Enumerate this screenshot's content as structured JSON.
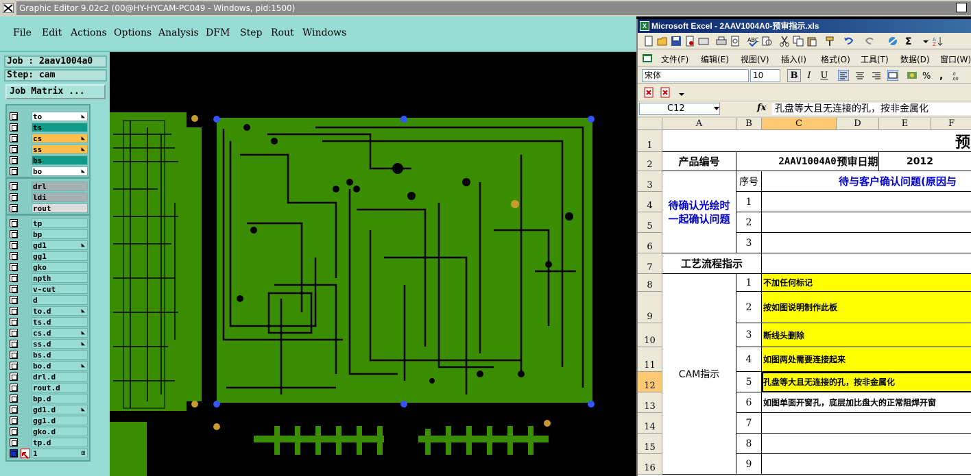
{
  "graphic_editor": {
    "title": "Graphic Editor 9.02c2 (00@HY-HYCAM-PC049 - Windows, pid:1500)",
    "menu": [
      "File",
      "Edit",
      "Actions",
      "Options",
      "Analysis",
      "DFM",
      "Step",
      "Rout",
      "Windows"
    ],
    "job_label": "Job : 2aav1004a0",
    "step_label": "Step: cam",
    "job_matrix_label": "Job Matrix ...",
    "layers": [
      {
        "name": "to",
        "color": "#ffffff",
        "mark": "◣"
      },
      {
        "name": "ts",
        "color": "#119a86",
        "mark": ""
      },
      {
        "name": "cs",
        "color": "#ffc04d",
        "mark": "◣"
      },
      {
        "name": "ss",
        "color": "#ffc04d",
        "mark": "◣"
      },
      {
        "name": "bs",
        "color": "#119a86",
        "mark": ""
      },
      {
        "name": "bo",
        "color": "#ffffff",
        "mark": "◣"
      },
      {
        "name": "drl",
        "color": "#a7b1b3",
        "mark": ""
      },
      {
        "name": "ldi",
        "color": "#a7b1b3",
        "mark": ""
      },
      {
        "name": "rout",
        "color": "#dcdcdc",
        "mark": ""
      },
      {
        "name": "tp",
        "color": "#99dcd4",
        "mark": ""
      },
      {
        "name": "bp",
        "color": "#99dcd4",
        "mark": ""
      },
      {
        "name": "gd1",
        "color": "#99dcd4",
        "mark": "◣"
      },
      {
        "name": "gg1",
        "color": "#99dcd4",
        "mark": ""
      },
      {
        "name": "gko",
        "color": "#99dcd4",
        "mark": ""
      },
      {
        "name": "npth",
        "color": "#99dcd4",
        "mark": ""
      },
      {
        "name": "v-cut",
        "color": "#99dcd4",
        "mark": ""
      },
      {
        "name": "d",
        "color": "#99dcd4",
        "mark": ""
      },
      {
        "name": "to.d",
        "color": "#99dcd4",
        "mark": "◣"
      },
      {
        "name": "ts.d",
        "color": "#99dcd4",
        "mark": ""
      },
      {
        "name": "cs.d",
        "color": "#99dcd4",
        "mark": "◣"
      },
      {
        "name": "ss.d",
        "color": "#99dcd4",
        "mark": "◣"
      },
      {
        "name": "bs.d",
        "color": "#99dcd4",
        "mark": ""
      },
      {
        "name": "bo.d",
        "color": "#99dcd4",
        "mark": "◣"
      },
      {
        "name": "drl.d",
        "color": "#99dcd4",
        "mark": ""
      },
      {
        "name": "rout.d",
        "color": "#99dcd4",
        "mark": ""
      },
      {
        "name": "bp.d",
        "color": "#99dcd4",
        "mark": ""
      },
      {
        "name": "gd1.d",
        "color": "#99dcd4",
        "mark": "◣"
      },
      {
        "name": "gg1.d",
        "color": "#99dcd4",
        "mark": ""
      },
      {
        "name": "gko.d",
        "color": "#99dcd4",
        "mark": ""
      },
      {
        "name": "tp.d",
        "color": "#99dcd4",
        "mark": ""
      },
      {
        "name": "1",
        "color": "#99dcd4",
        "mark": "⊞"
      }
    ],
    "board_color": "#3a8c00",
    "pad_color_blue": "#3355ff",
    "pad_color_gold": "#c89b2c"
  },
  "excel": {
    "title": "Microsoft Excel - 2AAV1004A0-预审指示.xls",
    "menu": [
      "文件(F)",
      "编辑(E)",
      "视图(V)",
      "插入(I)",
      "格式(O)",
      "工具(T)",
      "数据(D)",
      "窗口(W)"
    ],
    "font_name": "宋体",
    "font_size": "10",
    "name_box": "C12",
    "formula": "孔盘等大且无连接的孔，按非金属化",
    "columns": [
      "A",
      "B",
      "C",
      "D",
      "E",
      "F"
    ],
    "rows": [
      "1",
      "2",
      "3",
      "4",
      "5",
      "6",
      "7",
      "8",
      "9",
      "10",
      "11",
      "12",
      "13",
      "14",
      "15",
      "16"
    ],
    "cells": {
      "title": "预",
      "product_no_label": "产品编号",
      "product_no": "2AAV1004A0",
      "review_date_label": "预审日期",
      "review_date": "2012",
      "seq_label": "序号",
      "confirm_header": "待与客户确认问题(原因与",
      "confirm_group": "待确认光绘时一起确认问题",
      "confirm_nums": [
        "1",
        "2",
        "3"
      ],
      "process_label": "工艺流程指示",
      "cam_label": "CAM指示",
      "cam_items": [
        {
          "n": "1",
          "text": "不加任何标记",
          "yellow": true
        },
        {
          "n": "2",
          "text": "按如图说明制作此板",
          "yellow": true
        },
        {
          "n": "3",
          "text": "断线头删除",
          "yellow": true
        },
        {
          "n": "4",
          "text": "如图两处需要连接起来",
          "yellow": true
        },
        {
          "n": "5",
          "text": "孔盘等大且无连接的孔，按非金属化",
          "yellow": true
        },
        {
          "n": "6",
          "text": "如图单面开窗孔，底层加比盘大的正常阻焊开窗",
          "yellow": false
        },
        {
          "n": "7",
          "text": "",
          "yellow": false
        },
        {
          "n": "8",
          "text": "",
          "yellow": false
        },
        {
          "n": "9",
          "text": "",
          "yellow": false
        }
      ]
    }
  }
}
